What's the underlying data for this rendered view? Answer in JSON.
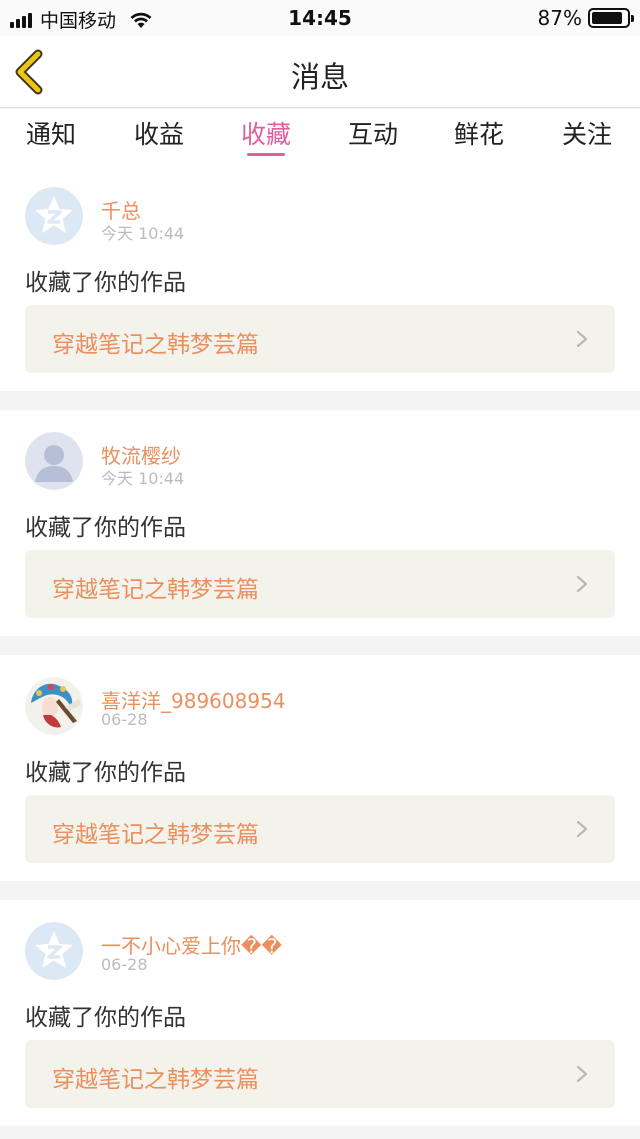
{
  "status_bar": {
    "carrier": "中国移动",
    "time": "14:45",
    "battery_pct": "87%",
    "battery_level": 0.87,
    "signal_icon": "signal-bars-icon",
    "wifi_icon": "wifi-icon"
  },
  "nav": {
    "title": "消息",
    "back_icon": "chevron-left-icon",
    "accent": "#f2c418"
  },
  "tabs": [
    "通知",
    "收益",
    "收藏",
    "互动",
    "鲜花",
    "关注"
  ],
  "active_tab": "收藏",
  "colors": {
    "accent_pink": "#e0609f",
    "username_orange": "#ec8f5e",
    "link_bg": "#f3f3ec"
  },
  "messages": [
    {
      "username": "千总",
      "time": "今天 10:44",
      "action": "收藏了你的作品",
      "work_title": "穿越笔记之韩梦芸篇",
      "avatar": "qq-default-avatar-icon"
    },
    {
      "username": "牧流樱纱",
      "time": "今天 10:44",
      "action": "收藏了你的作品",
      "work_title": "穿越笔记之韩梦芸篇",
      "avatar": "default-person-avatar-icon"
    },
    {
      "username": "喜洋洋_989608954",
      "time": "06-28",
      "action": "收藏了你的作品",
      "work_title": "穿越笔记之韩梦芸篇",
      "avatar": "opera-character-avatar"
    },
    {
      "username": "一不小心爱上你��",
      "time": "06-28",
      "action": "收藏了你的作品",
      "work_title": "穿越笔记之韩梦芸篇",
      "avatar": "qq-default-avatar-icon"
    }
  ]
}
